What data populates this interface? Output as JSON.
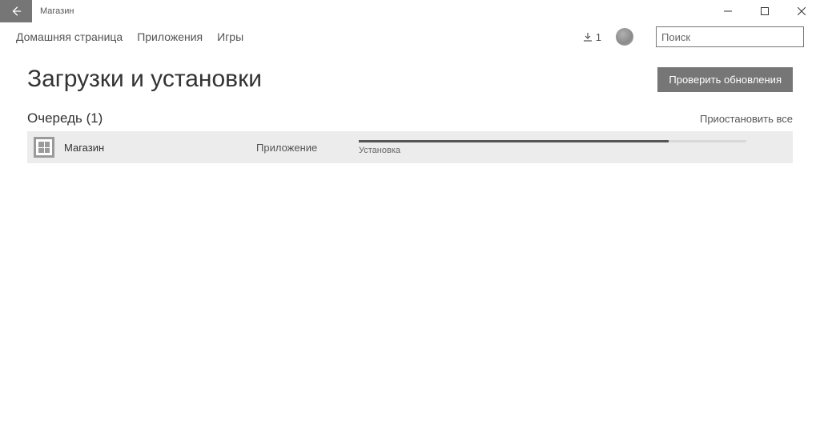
{
  "titlebar": {
    "app_name": "Магазин"
  },
  "nav": {
    "home": "Домашняя страница",
    "apps": "Приложения",
    "games": "Игры",
    "download_count": "1",
    "search_placeholder": "Поиск"
  },
  "page": {
    "title": "Загрузки и установки",
    "check_updates": "Проверить обновления"
  },
  "queue": {
    "header": "Очередь (1)",
    "pause_all": "Приостановить все",
    "items": [
      {
        "name": "Магазин",
        "type": "Приложение",
        "status": "Установка",
        "progress_percent": 80
      }
    ]
  }
}
